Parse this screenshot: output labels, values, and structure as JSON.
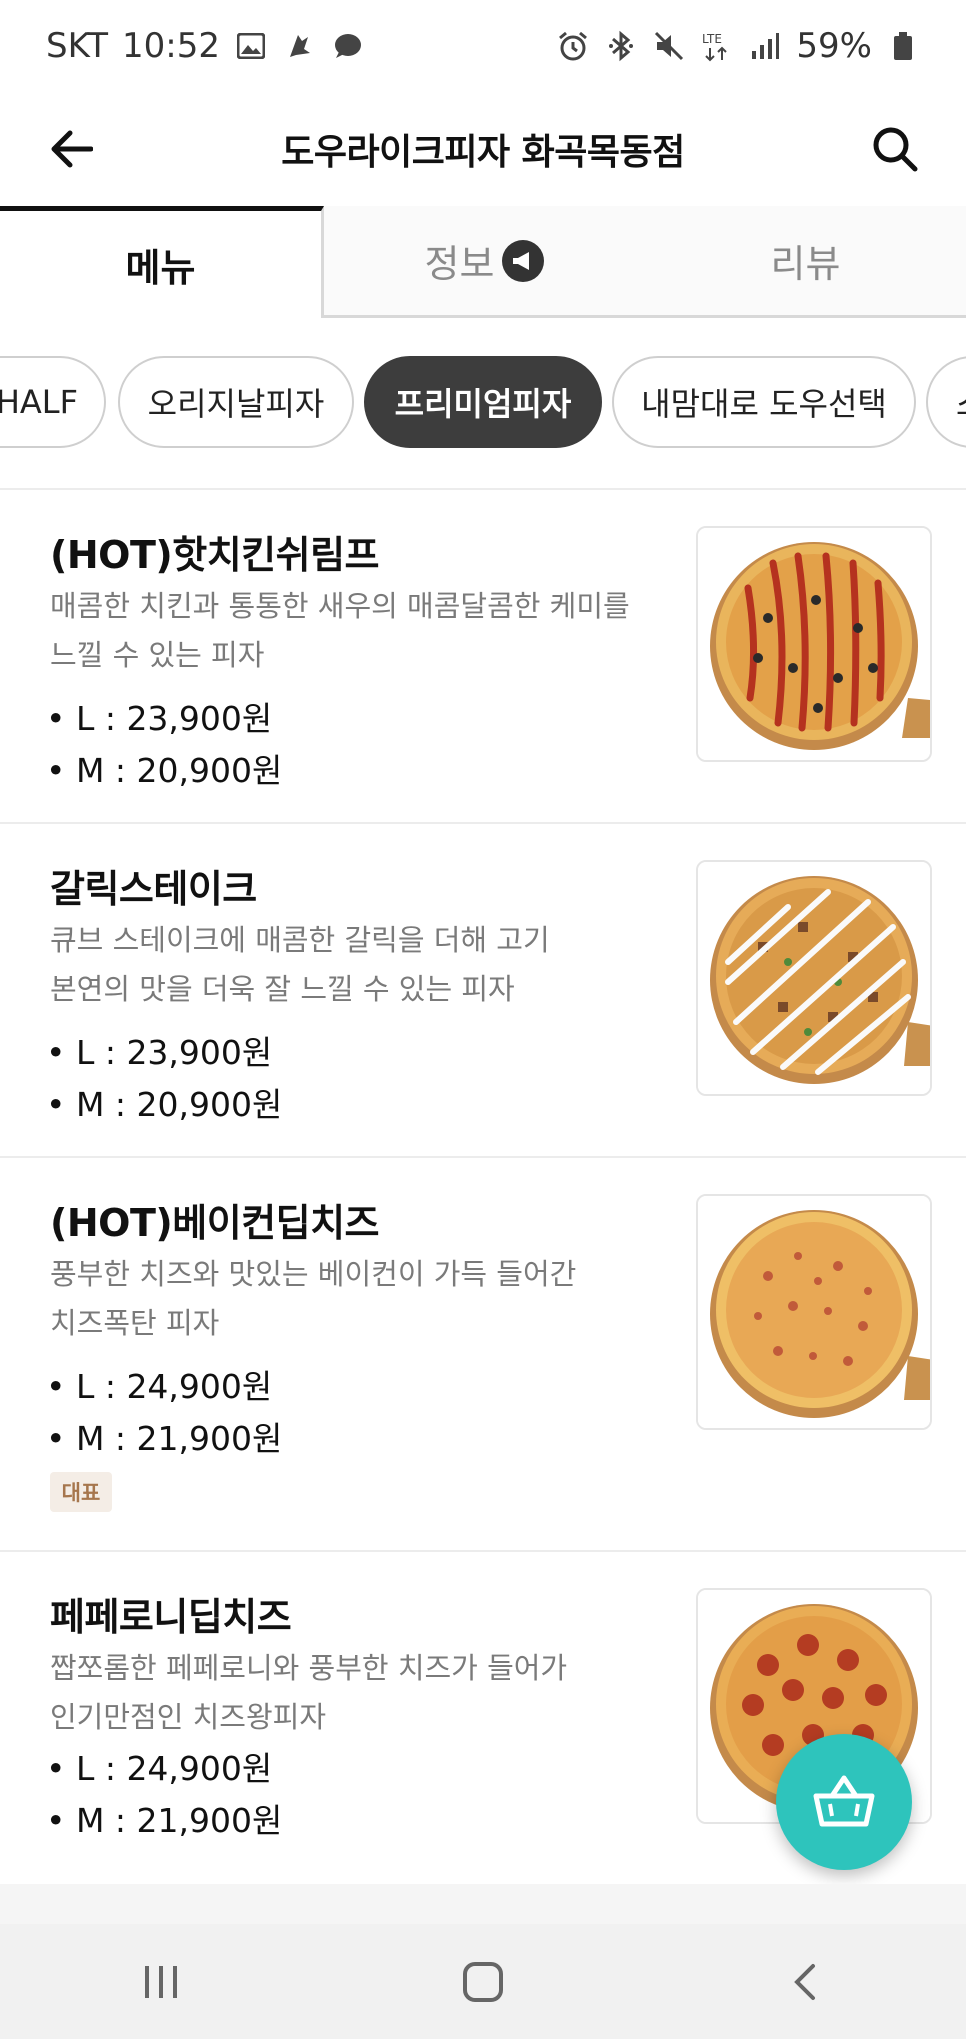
{
  "status_bar": {
    "carrier": "SKT",
    "time": "10:52",
    "battery": "59%",
    "icons_left": [
      "image-icon",
      "app-icon",
      "chat-icon"
    ],
    "icons_right": [
      "alarm-icon",
      "bluetooth-icon",
      "mute-icon",
      "lte-icon",
      "signal-icon",
      "battery-icon"
    ]
  },
  "header": {
    "title": "도우라이크피자 화곡목동점"
  },
  "tabs": [
    {
      "label": "메뉴",
      "active": true
    },
    {
      "label": "정보",
      "active": false
    },
    {
      "label": "리뷰",
      "active": false
    }
  ],
  "categories": [
    {
      "label": "HALF",
      "active": false
    },
    {
      "label": "오리지날피자",
      "active": false
    },
    {
      "label": "프리미엄피자",
      "active": true
    },
    {
      "label": "내맘대로 도우선택",
      "active": false
    },
    {
      "label": "스",
      "active": false
    }
  ],
  "menu_items": [
    {
      "name": "(HOT)핫치킨쉬림프",
      "desc_line1": "매콤한 치킨과 통통한 새우의 매콤달콤한 케미를",
      "desc_line2": "느낄 수 있는 피자",
      "price_l": "• L : 23,900원",
      "price_m": "• M : 20,900원"
    },
    {
      "name": "갈릭스테이크",
      "desc_line1": "큐브 스테이크에 매콤한 갈릭을 더해 고기",
      "desc_line2": "본연의 맛을 더욱 잘 느낄 수 있는 피자",
      "price_l": "• L : 23,900원",
      "price_m": "• M : 20,900원"
    },
    {
      "name": "(HOT)베이컨딥치즈",
      "desc_line1": "풍부한 치즈와 맛있는 베이컨이 가득 들어간",
      "desc_line2": "치즈폭탄 피자",
      "price_l": "• L : 24,900원",
      "price_m": "• M : 21,900원",
      "tag": "대표"
    },
    {
      "name": "페페로니딥치즈",
      "desc_line1": "짭쪼롬한 페페로니와 풍부한 치즈가 들어가",
      "desc_line2": "인기만점인 치즈왕피자",
      "price_l": "• L : 24,900원",
      "price_m": "• M : 21,900원"
    }
  ],
  "colors": {
    "accent_cart": "#2ec4bc",
    "chip_active": "#3d3d3d",
    "tag_bg": "#f4ede6",
    "tag_text": "#a6764d"
  }
}
